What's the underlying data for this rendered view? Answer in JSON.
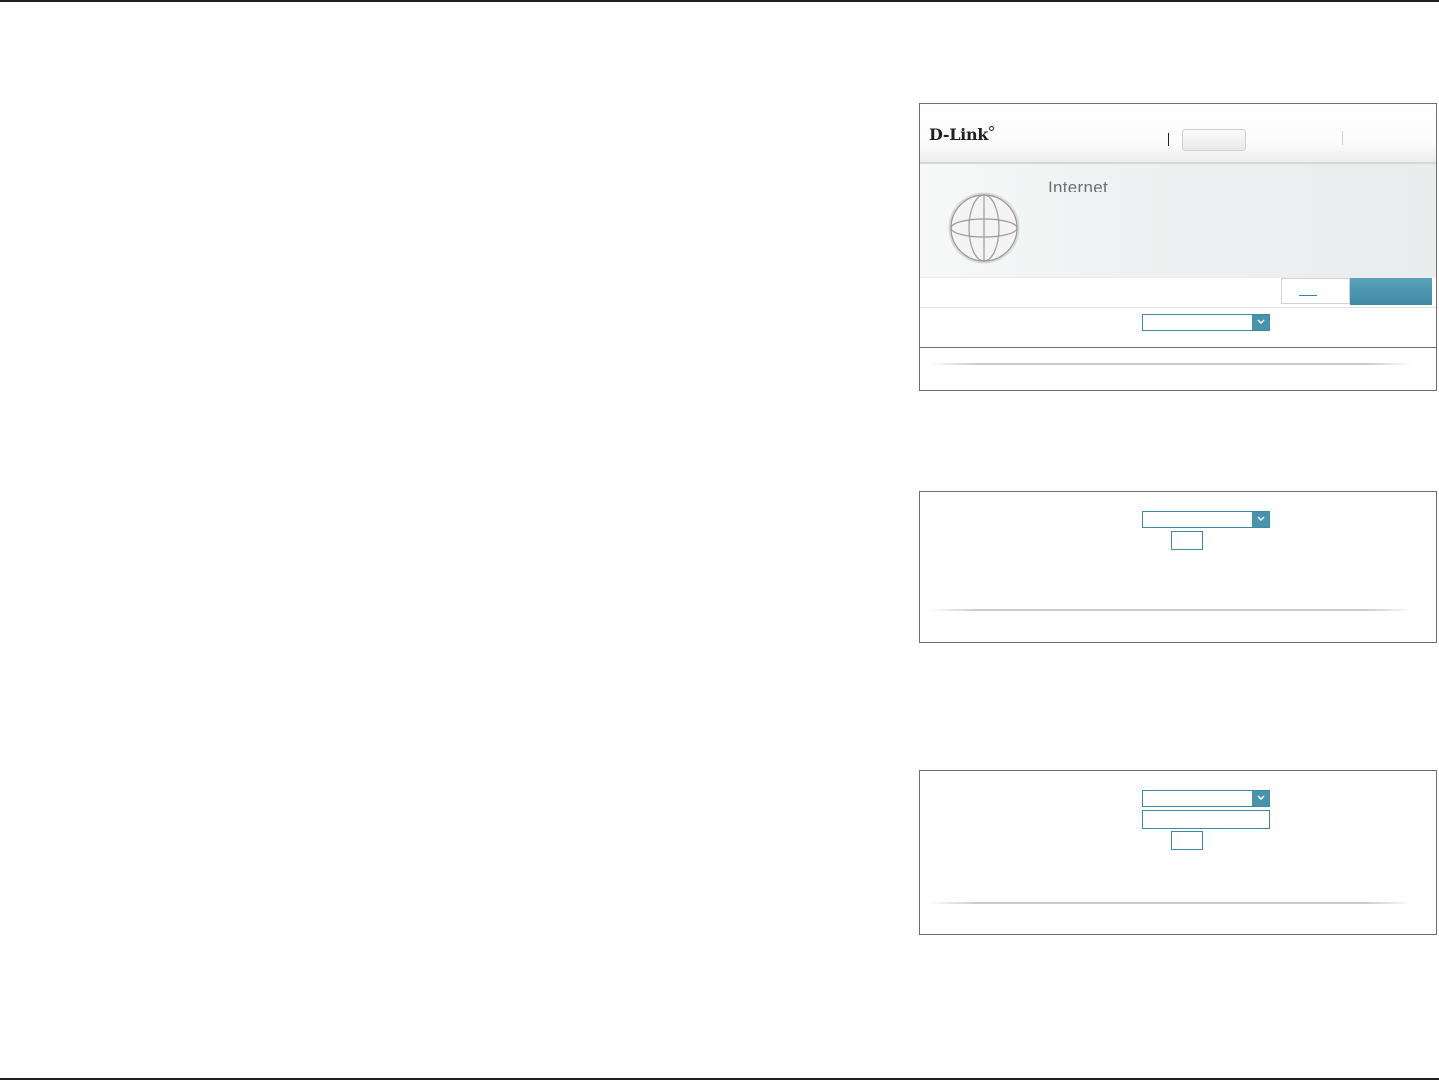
{
  "header": {
    "logo_text": "D-Link"
  },
  "banner": {
    "title": "Internet"
  },
  "icons": {
    "globe": "globe-icon",
    "dropdown": "chevron-down-icon"
  },
  "colors": {
    "accent": "#3e8aa5",
    "accent_button": "#4a93ac",
    "rule": "#231f20",
    "border": "#6d6e71"
  }
}
